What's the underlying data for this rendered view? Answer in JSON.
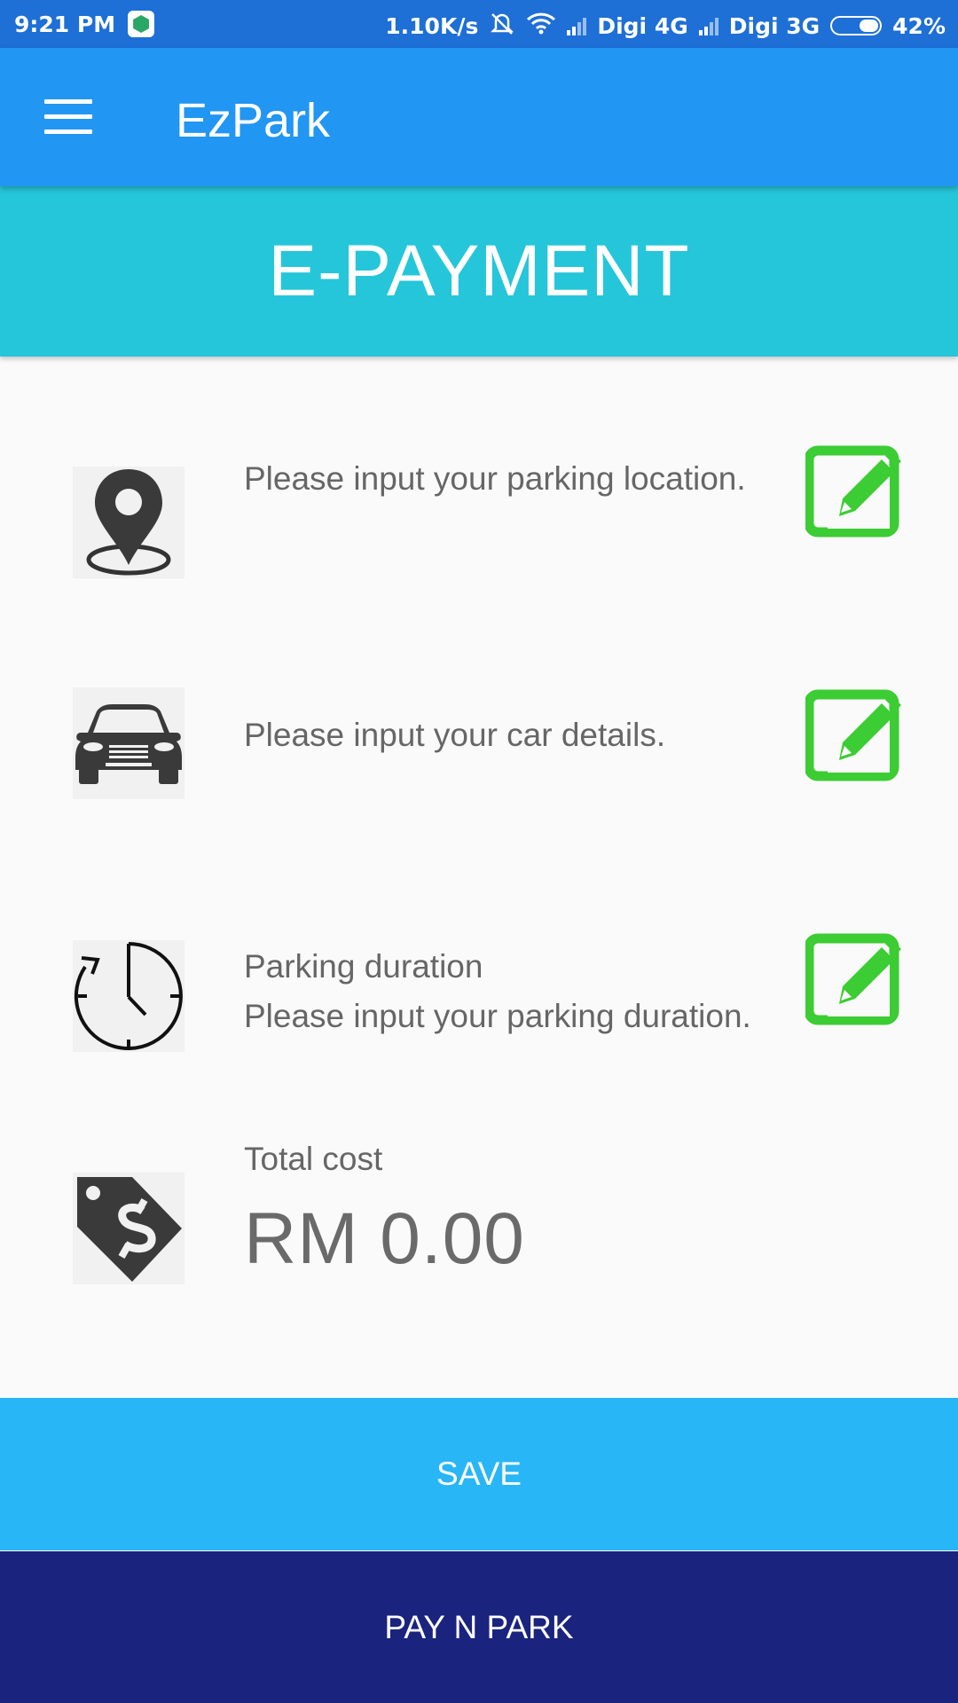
{
  "status_bar": {
    "time": "9:21 PM",
    "network_speed": "1.10K/s",
    "carrier_1": "Digi 4G",
    "carrier_2": "Digi 3G",
    "battery_text": "42%",
    "battery_level": 0.42,
    "icons": [
      "app-shield-icon",
      "mute-icon",
      "wifi-icon",
      "signal-icon",
      "battery-icon"
    ]
  },
  "app_bar": {
    "title": "EzPark",
    "menu_icon": "hamburger-menu-icon"
  },
  "banner": {
    "title": "E-PAYMENT"
  },
  "rows": [
    {
      "icon": "location-pin-icon",
      "text": "Please input your parking location.",
      "edit_icon": "edit-icon"
    },
    {
      "icon": "car-icon",
      "text": "Please input your car details.",
      "edit_icon": "edit-icon"
    },
    {
      "icon": "clock-icon",
      "title": "Parking duration",
      "text": "Please input your parking duration.",
      "edit_icon": "edit-icon"
    }
  ],
  "total": {
    "icon": "price-tag-icon",
    "label": "Total cost",
    "value": "RM 0.00"
  },
  "buttons": {
    "save": "SAVE",
    "pay": "PAY N PARK"
  },
  "colors": {
    "status_bar": "#1e6fd6",
    "app_bar": "#2196f3",
    "banner": "#26c6da",
    "edit_green": "#3ccc33",
    "save_button": "#29b6f6",
    "pay_button": "#1a237e"
  }
}
